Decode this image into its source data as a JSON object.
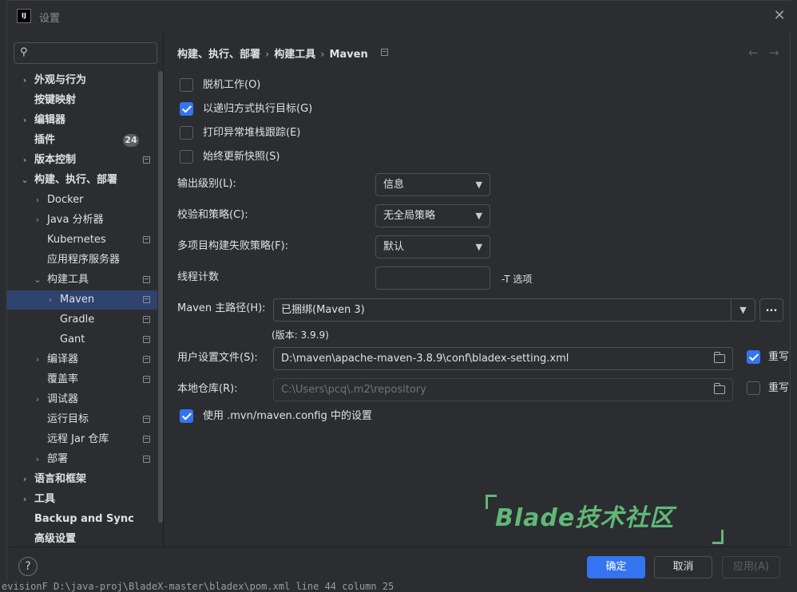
{
  "window": {
    "title": "设置",
    "app_icon_text": "IJ"
  },
  "background": {
    "status_text": "evisionF  D:\\java-proj\\BladeX-master\\bladex\\pom.xml  line 44  column 25"
  },
  "sidebar": {
    "search_placeholder": "",
    "items": [
      {
        "label": "外观与行为",
        "bold": true,
        "chevron": "right",
        "level": 0
      },
      {
        "label": "按键映射",
        "bold": true,
        "chevron": "",
        "level": 0
      },
      {
        "label": "编辑器",
        "bold": true,
        "chevron": "right",
        "level": 0
      },
      {
        "label": "插件",
        "bold": true,
        "chevron": "",
        "level": 0,
        "badge": "24"
      },
      {
        "label": "版本控制",
        "bold": true,
        "chevron": "right",
        "level": 0,
        "proj": true
      },
      {
        "label": "构建、执行、部署",
        "bold": true,
        "chevron": "down",
        "level": 0
      },
      {
        "label": "Docker",
        "bold": false,
        "chevron": "right",
        "level": 1
      },
      {
        "label": "Java 分析器",
        "bold": false,
        "chevron": "right",
        "level": 1
      },
      {
        "label": "Kubernetes",
        "bold": false,
        "chevron": "",
        "level": 1,
        "proj": true
      },
      {
        "label": "应用程序服务器",
        "bold": false,
        "chevron": "",
        "level": 1
      },
      {
        "label": "构建工具",
        "bold": false,
        "chevron": "down",
        "level": 1,
        "proj": true
      },
      {
        "label": "Maven",
        "bold": false,
        "chevron": "right",
        "level": 2,
        "proj": true,
        "selected": true
      },
      {
        "label": "Gradle",
        "bold": false,
        "chevron": "",
        "level": 2,
        "proj": true
      },
      {
        "label": "Gant",
        "bold": false,
        "chevron": "",
        "level": 2,
        "proj": true
      },
      {
        "label": "编译器",
        "bold": false,
        "chevron": "right",
        "level": 1,
        "proj": true
      },
      {
        "label": "覆盖率",
        "bold": false,
        "chevron": "",
        "level": 1,
        "proj": true
      },
      {
        "label": "调试器",
        "bold": false,
        "chevron": "right",
        "level": 1
      },
      {
        "label": "运行目标",
        "bold": false,
        "chevron": "",
        "level": 1,
        "proj": true
      },
      {
        "label": "远程 Jar 仓库",
        "bold": false,
        "chevron": "",
        "level": 1,
        "proj": true
      },
      {
        "label": "部署",
        "bold": false,
        "chevron": "right",
        "level": 1,
        "proj": true
      },
      {
        "label": "语言和框架",
        "bold": true,
        "chevron": "right",
        "level": 0
      },
      {
        "label": "工具",
        "bold": true,
        "chevron": "right",
        "level": 0
      },
      {
        "label": "Backup and Sync",
        "bold": true,
        "chevron": "",
        "level": 0
      },
      {
        "label": "高级设置",
        "bold": true,
        "chevron": "",
        "level": 0
      }
    ]
  },
  "breadcrumb": {
    "part1": "构建、执行、部署",
    "part2": "构建工具",
    "part3": "Maven"
  },
  "options": {
    "offline": {
      "label": "脱机工作(O)",
      "checked": false
    },
    "recursive": {
      "label": "以递归方式执行目标(G)",
      "checked": true
    },
    "stacktrace": {
      "label": "打印异常堆栈跟踪(E)",
      "checked": false
    },
    "update_snapshots": {
      "label": "始终更新快照(S)",
      "checked": false
    }
  },
  "form": {
    "output_level": {
      "label": "输出级别(L):",
      "value": "信息"
    },
    "checksum": {
      "label": "校验和策略(C):",
      "value": "无全局策略"
    },
    "multiproject": {
      "label": "多项目构建失败策略(F):",
      "value": "默认"
    },
    "threads": {
      "label": "线程计数",
      "value": "",
      "hint": "-T 选项"
    },
    "maven_home": {
      "label": "Maven 主路径(H):",
      "value": "已捆绑(Maven 3)",
      "version": "(版本: 3.9.9)",
      "dots": "..."
    },
    "user_settings": {
      "label": "用户设置文件(S):",
      "value": "D:\\maven\\apache-maven-3.8.9\\conf\\bladex-setting.xml",
      "override_label": "重写",
      "override": true
    },
    "local_repo": {
      "label": "本地仓库(R):",
      "value": "C:\\Users\\pcq\\.m2\\repository",
      "override_label": "重写",
      "override": false
    },
    "use_mvn_config": {
      "label": "使用 .mvn/maven.config 中的设置",
      "checked": true
    }
  },
  "watermark": {
    "text": "Blade技术社区"
  },
  "footer": {
    "help": "?",
    "ok": "确定",
    "cancel": "取消",
    "apply": "应用(A)"
  },
  "colors": {
    "accent": "#3574f0",
    "selected_row": "#2e436e",
    "watermark": "#5fb878"
  }
}
